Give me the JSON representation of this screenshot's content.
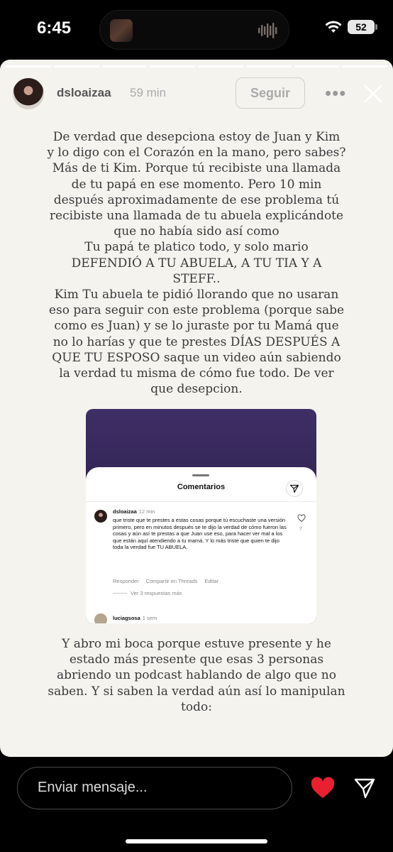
{
  "status_bar": {
    "time": "6:45",
    "battery": "52"
  },
  "story": {
    "username": "dsloaizaa",
    "time_ago": "59 min",
    "follow_label": "Seguir",
    "more_label": "•••",
    "text_top": "De verdad que desepciona estoy de Juan y Kim\ny lo digo con el Corazón en la mano, pero sabes?\nMás de ti Kim. Porque tú recibiste una llamada\nde tu papá en ese momento. Pero 10 min\ndespués aproximadamente de ese problema tú\nrecibiste una llamada de tu abuela explicándote\nque no había sido así como\nTu papá te platico todo, y solo mario\nDEFENDIÓ A TU ABUELA, A TU TIA Y A\nSTEFF..\nKim Tu abuela te pidió llorando que no usaran\neso para seguir con este problema (porque sabe\ncomo es Juan)  y se lo juraste por tu Mamá que\nno lo harías y que te prestes DÍAS DESPUÉS A\nQUE TU ESPOSO saque un video aún sabiendo\nla verdad tu misma de cómo fue todo. De ver\nque desepcion.",
    "text_bottom": "Y abro mi boca porque estuve presente y he\nestado más presente que esas 3 personas\nabriendo un podcast hablando de algo que no\nsaben. Y si saben la verdad aún así lo manipulan\ntodo:"
  },
  "embedded_screenshot": {
    "title": "Comentarios",
    "comment": {
      "username": "dsloaizaa",
      "time": "12 min",
      "text": "que triste que te prestes a estas cosas porque tú escuchaste una versión primero, pero en minutos después se te dijo la verdad de cómo fueron las cosas y aún así te prestas a que Juan use eso, para hacer ver mal a los que están aquí atendiendo a tu mamá. Y lo más triste que quien te dijo toda la verdad fue TU ABUELA.",
      "like_count": "7",
      "reply_label": "Responder",
      "share_label": "Compartir en Threads",
      "edit_label": "Editar",
      "view_replies": "Ver 3 respuestas más"
    },
    "next_comment": {
      "username": "luciagsosa",
      "time": "1 sem"
    }
  },
  "reply_bar": {
    "placeholder": "Enviar mensaje..."
  },
  "colors": {
    "story_bg": "#f5f3ee",
    "heart": "#e8202f",
    "app_bg": "#000000"
  }
}
